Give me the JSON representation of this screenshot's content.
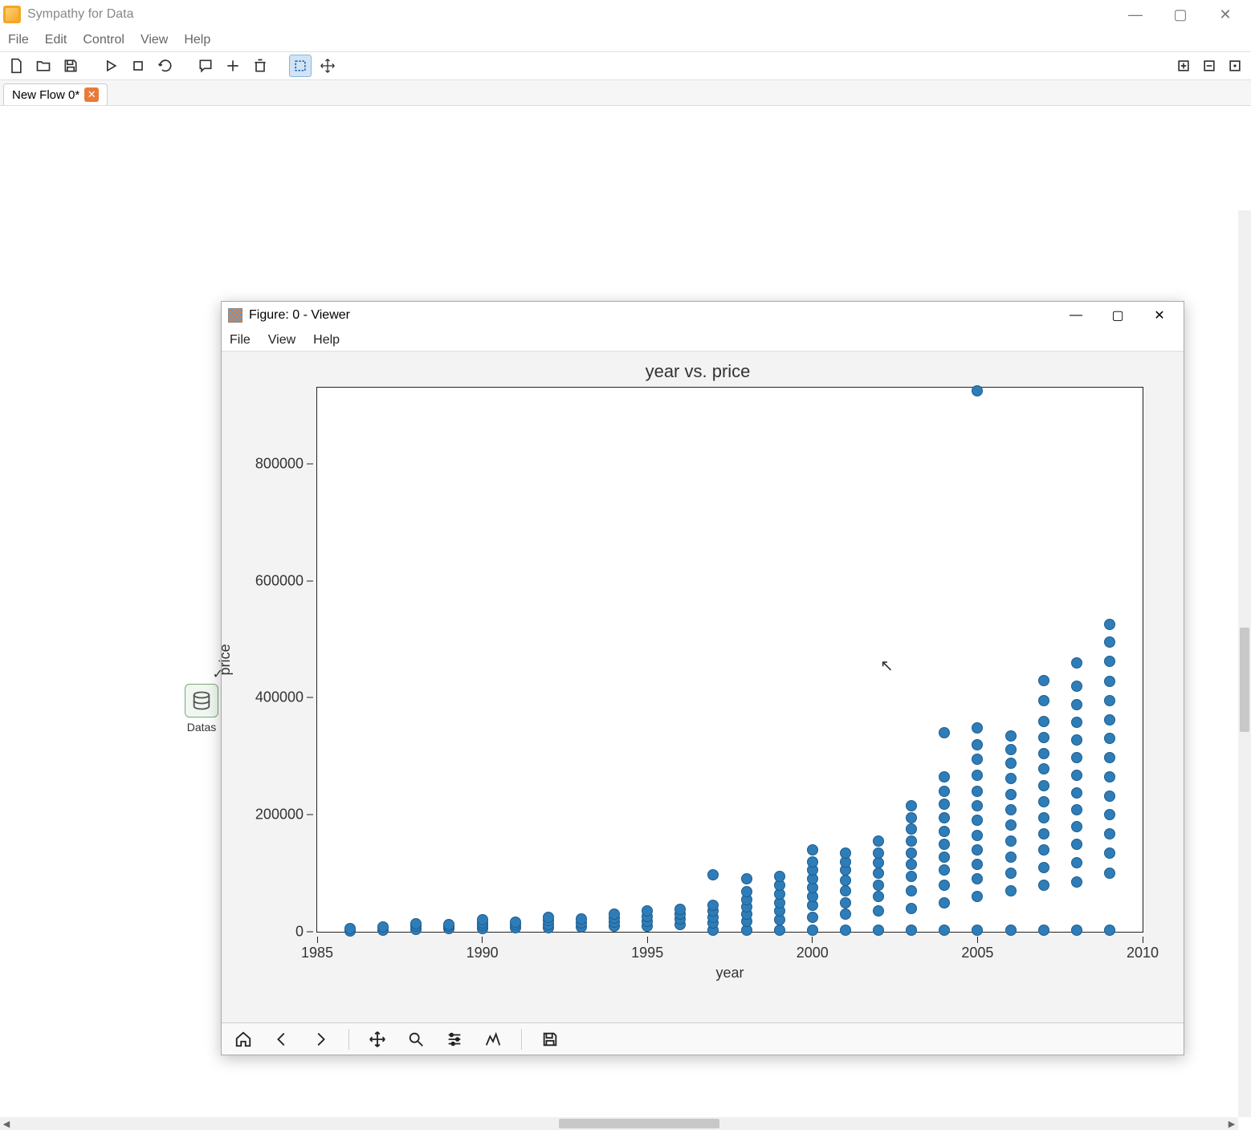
{
  "app": {
    "title": "Sympathy for Data"
  },
  "main_menu": [
    "File",
    "Edit",
    "Control",
    "View",
    "Help"
  ],
  "toolbar_icons": [
    "new-file-icon",
    "open-file-icon",
    "save-icon",
    "run-icon",
    "stop-icon",
    "reload-icon",
    "comment-icon",
    "add-icon",
    "delete-icon",
    "select-icon",
    "move-icon"
  ],
  "toolbar_right_icons": [
    "expand-icon",
    "collapse-icon",
    "fit-icon"
  ],
  "tab": {
    "label": "New Flow 0*"
  },
  "node": {
    "label": "Datas"
  },
  "viewer": {
    "title": "Figure: 0 - Viewer",
    "menu": [
      "File",
      "View",
      "Help"
    ],
    "toolbar_icons": [
      "home-icon",
      "back-icon",
      "forward-icon",
      "pan-icon",
      "zoom-icon",
      "config-icon",
      "edit-axes-icon",
      "save-figure-icon"
    ]
  },
  "chart_data": {
    "type": "scatter",
    "title": "year vs. price",
    "xlabel": "year",
    "ylabel": "price",
    "xlim": [
      1985,
      2010
    ],
    "ylim": [
      0,
      930000
    ],
    "x_ticks": [
      1985,
      1990,
      1995,
      2000,
      2005,
      2010
    ],
    "y_ticks": [
      0,
      200000,
      400000,
      600000,
      800000
    ],
    "series": [
      {
        "name": "price",
        "points": [
          [
            1986,
            2000
          ],
          [
            1986,
            5000
          ],
          [
            1987,
            3000
          ],
          [
            1987,
            8000
          ],
          [
            1988,
            4000
          ],
          [
            1988,
            10000
          ],
          [
            1988,
            14000
          ],
          [
            1989,
            5000
          ],
          [
            1989,
            9000
          ],
          [
            1989,
            13000
          ],
          [
            1990,
            6000
          ],
          [
            1990,
            11000
          ],
          [
            1990,
            15000
          ],
          [
            1990,
            20000
          ],
          [
            1991,
            7000
          ],
          [
            1991,
            12000
          ],
          [
            1991,
            17000
          ],
          [
            1992,
            7000
          ],
          [
            1992,
            13000
          ],
          [
            1992,
            19000
          ],
          [
            1992,
            25000
          ],
          [
            1993,
            8000
          ],
          [
            1993,
            15000
          ],
          [
            1993,
            22000
          ],
          [
            1994,
            9000
          ],
          [
            1994,
            16000
          ],
          [
            1994,
            24000
          ],
          [
            1994,
            30000
          ],
          [
            1995,
            10000
          ],
          [
            1995,
            18000
          ],
          [
            1995,
            26000
          ],
          [
            1995,
            35000
          ],
          [
            1996,
            12000
          ],
          [
            1996,
            22000
          ],
          [
            1996,
            30000
          ],
          [
            1996,
            38000
          ],
          [
            1997,
            3000
          ],
          [
            1997,
            15000
          ],
          [
            1997,
            25000
          ],
          [
            1997,
            35000
          ],
          [
            1997,
            45000
          ],
          [
            1997,
            98000
          ],
          [
            1998,
            3000
          ],
          [
            1998,
            18000
          ],
          [
            1998,
            30000
          ],
          [
            1998,
            42000
          ],
          [
            1998,
            55000
          ],
          [
            1998,
            68000
          ],
          [
            1998,
            90000
          ],
          [
            1999,
            3000
          ],
          [
            1999,
            20000
          ],
          [
            1999,
            35000
          ],
          [
            1999,
            50000
          ],
          [
            1999,
            65000
          ],
          [
            1999,
            80000
          ],
          [
            1999,
            95000
          ],
          [
            2000,
            3000
          ],
          [
            2000,
            25000
          ],
          [
            2000,
            45000
          ],
          [
            2000,
            60000
          ],
          [
            2000,
            75000
          ],
          [
            2000,
            90000
          ],
          [
            2000,
            105000
          ],
          [
            2000,
            120000
          ],
          [
            2000,
            140000
          ],
          [
            2001,
            3000
          ],
          [
            2001,
            30000
          ],
          [
            2001,
            50000
          ],
          [
            2001,
            70000
          ],
          [
            2001,
            88000
          ],
          [
            2001,
            105000
          ],
          [
            2001,
            120000
          ],
          [
            2001,
            135000
          ],
          [
            2002,
            3000
          ],
          [
            2002,
            35000
          ],
          [
            2002,
            60000
          ],
          [
            2002,
            80000
          ],
          [
            2002,
            100000
          ],
          [
            2002,
            118000
          ],
          [
            2002,
            135000
          ],
          [
            2002,
            155000
          ],
          [
            2003,
            3000
          ],
          [
            2003,
            40000
          ],
          [
            2003,
            70000
          ],
          [
            2003,
            95000
          ],
          [
            2003,
            115000
          ],
          [
            2003,
            135000
          ],
          [
            2003,
            155000
          ],
          [
            2003,
            175000
          ],
          [
            2003,
            195000
          ],
          [
            2003,
            215000
          ],
          [
            2004,
            3000
          ],
          [
            2004,
            50000
          ],
          [
            2004,
            80000
          ],
          [
            2004,
            105000
          ],
          [
            2004,
            128000
          ],
          [
            2004,
            150000
          ],
          [
            2004,
            172000
          ],
          [
            2004,
            195000
          ],
          [
            2004,
            218000
          ],
          [
            2004,
            240000
          ],
          [
            2004,
            265000
          ],
          [
            2004,
            340000
          ],
          [
            2005,
            3000
          ],
          [
            2005,
            60000
          ],
          [
            2005,
            90000
          ],
          [
            2005,
            115000
          ],
          [
            2005,
            140000
          ],
          [
            2005,
            165000
          ],
          [
            2005,
            190000
          ],
          [
            2005,
            215000
          ],
          [
            2005,
            240000
          ],
          [
            2005,
            268000
          ],
          [
            2005,
            295000
          ],
          [
            2005,
            320000
          ],
          [
            2005,
            348000
          ],
          [
            2005,
            925000
          ],
          [
            2006,
            3000
          ],
          [
            2006,
            70000
          ],
          [
            2006,
            100000
          ],
          [
            2006,
            128000
          ],
          [
            2006,
            155000
          ],
          [
            2006,
            182000
          ],
          [
            2006,
            208000
          ],
          [
            2006,
            235000
          ],
          [
            2006,
            262000
          ],
          [
            2006,
            288000
          ],
          [
            2006,
            312000
          ],
          [
            2006,
            335000
          ],
          [
            2007,
            3000
          ],
          [
            2007,
            80000
          ],
          [
            2007,
            110000
          ],
          [
            2007,
            140000
          ],
          [
            2007,
            168000
          ],
          [
            2007,
            195000
          ],
          [
            2007,
            222000
          ],
          [
            2007,
            250000
          ],
          [
            2007,
            278000
          ],
          [
            2007,
            305000
          ],
          [
            2007,
            332000
          ],
          [
            2007,
            360000
          ],
          [
            2007,
            395000
          ],
          [
            2007,
            430000
          ],
          [
            2008,
            3000
          ],
          [
            2008,
            85000
          ],
          [
            2008,
            118000
          ],
          [
            2008,
            150000
          ],
          [
            2008,
            180000
          ],
          [
            2008,
            208000
          ],
          [
            2008,
            238000
          ],
          [
            2008,
            268000
          ],
          [
            2008,
            298000
          ],
          [
            2008,
            328000
          ],
          [
            2008,
            358000
          ],
          [
            2008,
            388000
          ],
          [
            2008,
            420000
          ],
          [
            2008,
            460000
          ],
          [
            2009,
            3000
          ],
          [
            2009,
            100000
          ],
          [
            2009,
            135000
          ],
          [
            2009,
            168000
          ],
          [
            2009,
            200000
          ],
          [
            2009,
            232000
          ],
          [
            2009,
            265000
          ],
          [
            2009,
            298000
          ],
          [
            2009,
            330000
          ],
          [
            2009,
            362000
          ],
          [
            2009,
            395000
          ],
          [
            2009,
            428000
          ],
          [
            2009,
            462000
          ],
          [
            2009,
            495000
          ],
          [
            2009,
            525000
          ]
        ]
      }
    ]
  }
}
